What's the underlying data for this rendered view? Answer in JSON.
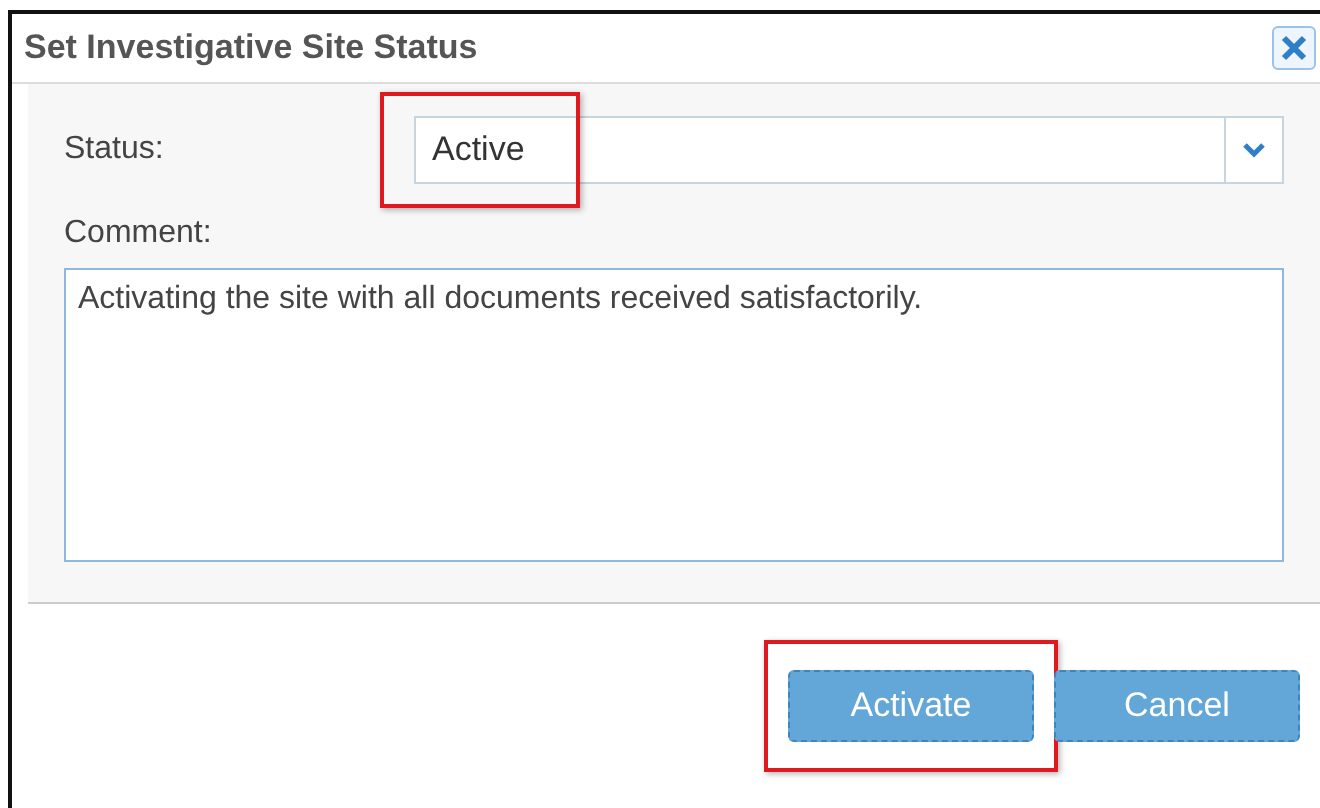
{
  "dialog": {
    "title": "Set Investigative Site Status",
    "status": {
      "label": "Status:",
      "value": "Active",
      "highlighted": true
    },
    "comment": {
      "label": "Comment:",
      "value": "Activating the site with all documents received satisfactorily."
    },
    "buttons": [
      {
        "label": "Activate",
        "highlighted": true
      },
      {
        "label": "Cancel",
        "highlighted": false
      }
    ]
  }
}
